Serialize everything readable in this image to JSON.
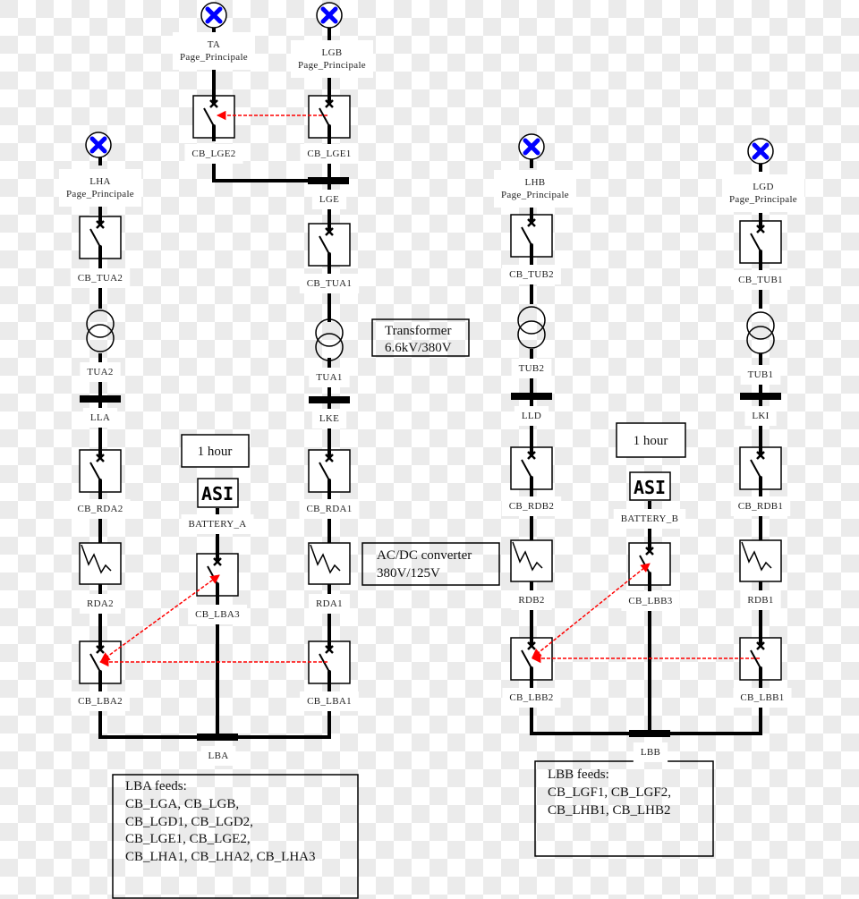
{
  "diagram": {
    "colors": {
      "line": "#000000",
      "link": "#ff0000",
      "page_ref": "#0000ff",
      "label_bg": "#ffffff"
    },
    "page_refs": [
      {
        "id": "ta",
        "name": "TA",
        "page": "Page_Principale",
        "icon": "blue-x-circle-icon"
      },
      {
        "id": "lgb",
        "name": "LGB",
        "page": "Page_Principale",
        "icon": "blue-x-circle-icon"
      },
      {
        "id": "lha",
        "name": "LHA",
        "page": "Page_Principale",
        "icon": "blue-x-circle-icon"
      },
      {
        "id": "lhb",
        "name": "LHB",
        "page": "Page_Principale",
        "icon": "blue-x-circle-icon"
      },
      {
        "id": "lgd",
        "name": "LGD",
        "page": "Page_Principale",
        "icon": "blue-x-circle-icon"
      }
    ],
    "breakers": {
      "cb_lge2": "CB_LGE2",
      "cb_lge1": "CB_LGE1",
      "cb_tua2": "CB_TUA2",
      "cb_tua1": "CB_TUA1",
      "cb_rda2": "CB_RDA2",
      "cb_rda1": "CB_RDA1",
      "cb_lba3": "CB_LBA3",
      "cb_lba2": "CB_LBA2",
      "cb_lba1": "CB_LBA1",
      "cb_tub2": "CB_TUB2",
      "cb_tub1": "CB_TUB1",
      "cb_rdb2": "CB_RDB2",
      "cb_rdb1": "CB_RDB1",
      "cb_lbb3": "CB_LBB3",
      "cb_lbb2": "CB_LBB2",
      "cb_lbb1": "CB_LBB1"
    },
    "transformers": {
      "tua2": "TUA2",
      "tua1": "TUA1",
      "tub2": "TUB2",
      "tub1": "TUB1"
    },
    "rectifiers": {
      "rda2": "RDA2",
      "rda1": "RDA1",
      "rdb2": "RDB2",
      "rdb1": "RDB1"
    },
    "buses": {
      "lge": "LGE",
      "lla": "LLA",
      "lke": "LKE",
      "lld": "LLD",
      "lki": "LKI",
      "lba": "LBA",
      "lbb": "LBB"
    },
    "batteries": {
      "a": {
        "label": "BATTERY_A",
        "display": "ASI",
        "autonomy": "1 hour"
      },
      "b": {
        "label": "BATTERY_B",
        "display": "ASI",
        "autonomy": "1 hour"
      }
    },
    "notes": {
      "transformer": [
        "Transformer",
        "6.6kV/380V"
      ],
      "converter": [
        "AC/DC converter",
        "380V/125V"
      ],
      "lba_feeds": [
        "LBA feeds:",
        "CB_LGA, CB_LGB,",
        "CB_LGD1, CB_LGD2,",
        "CB_LGE1, CB_LGE2,",
        "CB_LHA1, CB_LHA2, CB_LHA3"
      ],
      "lbb_feeds": [
        "LBB feeds:",
        "CB_LGF1, CB_LGF2,",
        "CB_LHB1, CB_LHB2"
      ]
    },
    "interlocks": [
      {
        "from": "CB_LGE1",
        "to": "CB_LGE2"
      },
      {
        "from": "CB_LBA1",
        "to": "CB_LBA2"
      },
      {
        "from": "CB_LBA2",
        "to": "CB_LBA3",
        "bidirectional": true
      },
      {
        "from": "CB_LBB1",
        "to": "CB_LBB2"
      },
      {
        "from": "CB_LBB2",
        "to": "CB_LBB3",
        "bidirectional": true
      }
    ]
  }
}
